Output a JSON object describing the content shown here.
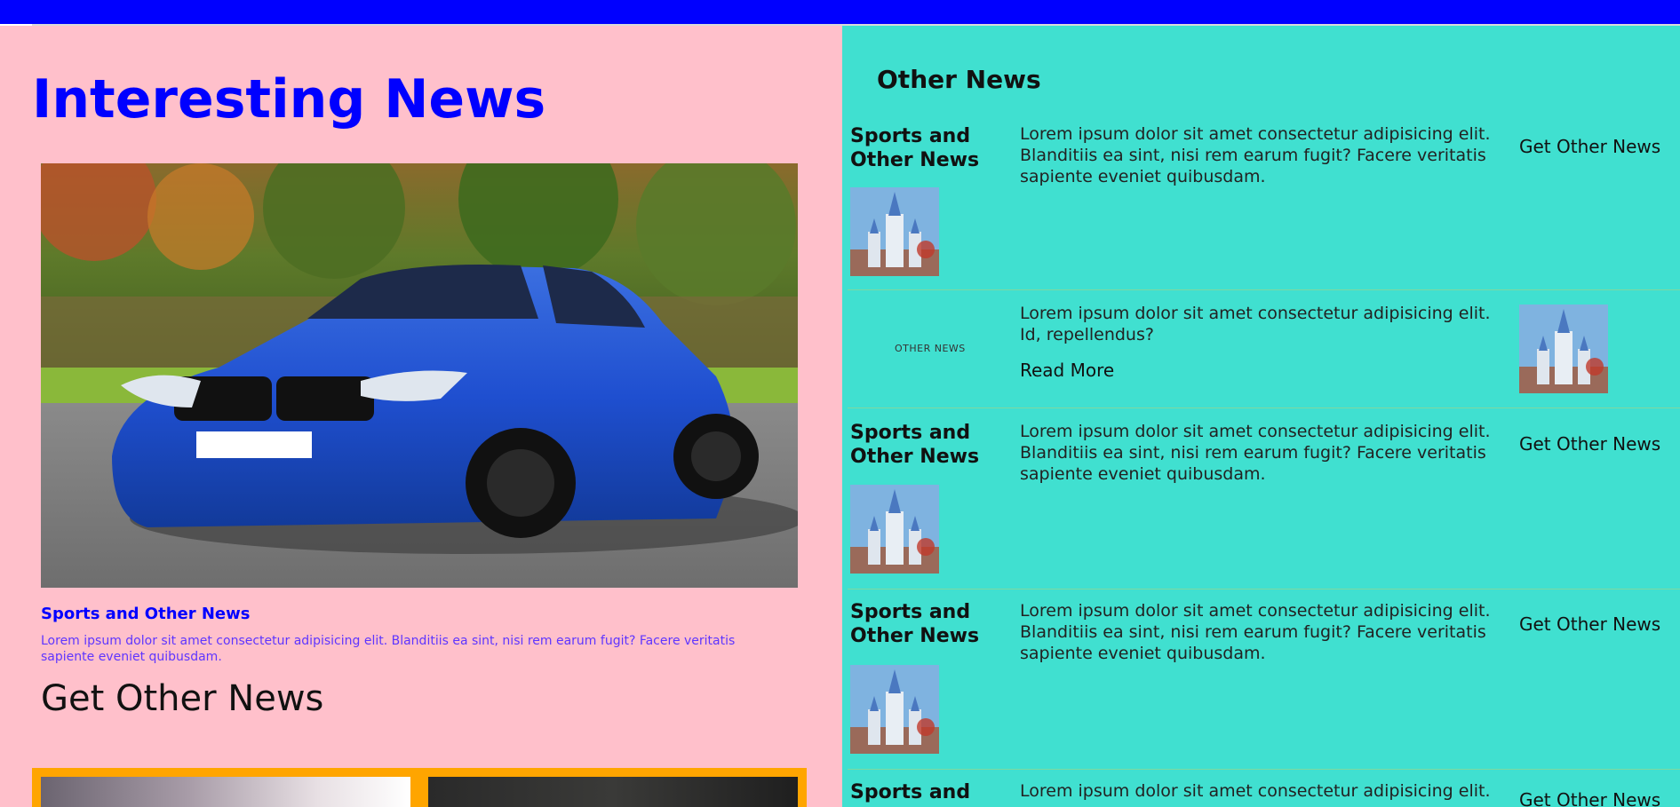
{
  "header": {
    "color": "#0000ff"
  },
  "left": {
    "title": "Interesting News",
    "feature": {
      "heading": "Sports and Other News",
      "text": "Lorem ipsum dolor sit amet consectetur adipisicing elit. Blanditiis ea sint, nisi rem earum fugit? Facere veritatis sapiente eveniet quibusdam."
    },
    "get_other_news": "Get Other News",
    "colors": {
      "background": "#ffc0cb",
      "accent": "#0000ff",
      "strip": "#ffa500"
    }
  },
  "right": {
    "title": "Other News",
    "colors": {
      "background": "#40e0d0"
    },
    "rows": [
      {
        "heading": "Sports and Other News",
        "text": "Lorem ipsum dolor sit amet consectetur adipisicing elit. Blanditiis ea sint, nisi rem earum fugit? Facere veritatis sapiente eveniet quibusdam.",
        "link": "Get Other News"
      },
      {
        "small_label": "OTHER NEWS",
        "text": "Lorem ipsum dolor sit amet consectetur adipisicing elit. Id, repellendus?",
        "read_more": "Read More"
      },
      {
        "heading": "Sports and Other News",
        "text": "Lorem ipsum dolor sit amet consectetur adipisicing elit. Blanditiis ea sint, nisi rem earum fugit? Facere veritatis sapiente eveniet quibusdam.",
        "link": "Get Other News"
      },
      {
        "heading": "Sports and Other News",
        "text": "Lorem ipsum dolor sit amet consectetur adipisicing elit. Blanditiis ea sint, nisi rem earum fugit? Facere veritatis sapiente eveniet quibusdam.",
        "link": "Get Other News"
      },
      {
        "heading": "Sports and",
        "text": "Lorem ipsum dolor sit amet consectetur adipisicing elit.",
        "link": "Get Other News"
      }
    ]
  }
}
